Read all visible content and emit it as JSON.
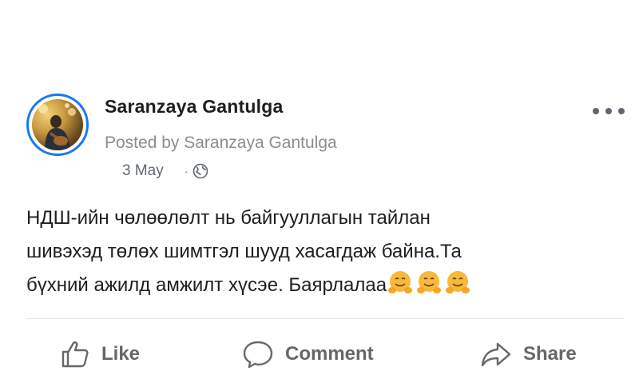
{
  "post": {
    "author": "Saranzaya Gantulga",
    "posted_by": "Posted by Saranzaya Gantulga",
    "date": "3 May",
    "privacy_icon": "globe-icon",
    "text_line1": "НДШ-ийн чөлөөлөлт нь байгууллагын тайлан",
    "text_line2": "шивэхэд төлөх шимтгэл шууд хасагдаж байна.Та",
    "text_line3": "бүхний ажилд амжилт хүсэе. Баярлалаа",
    "emoji": "hugging-face-emoji",
    "emoji_count": 3
  },
  "actions": {
    "like_label": "Like",
    "comment_label": "Comment",
    "share_label": "Share"
  },
  "colors": {
    "accent": "#1877f2",
    "text": "#1c1e21",
    "muted": "#65676b",
    "subtle": "#8a8d91"
  }
}
